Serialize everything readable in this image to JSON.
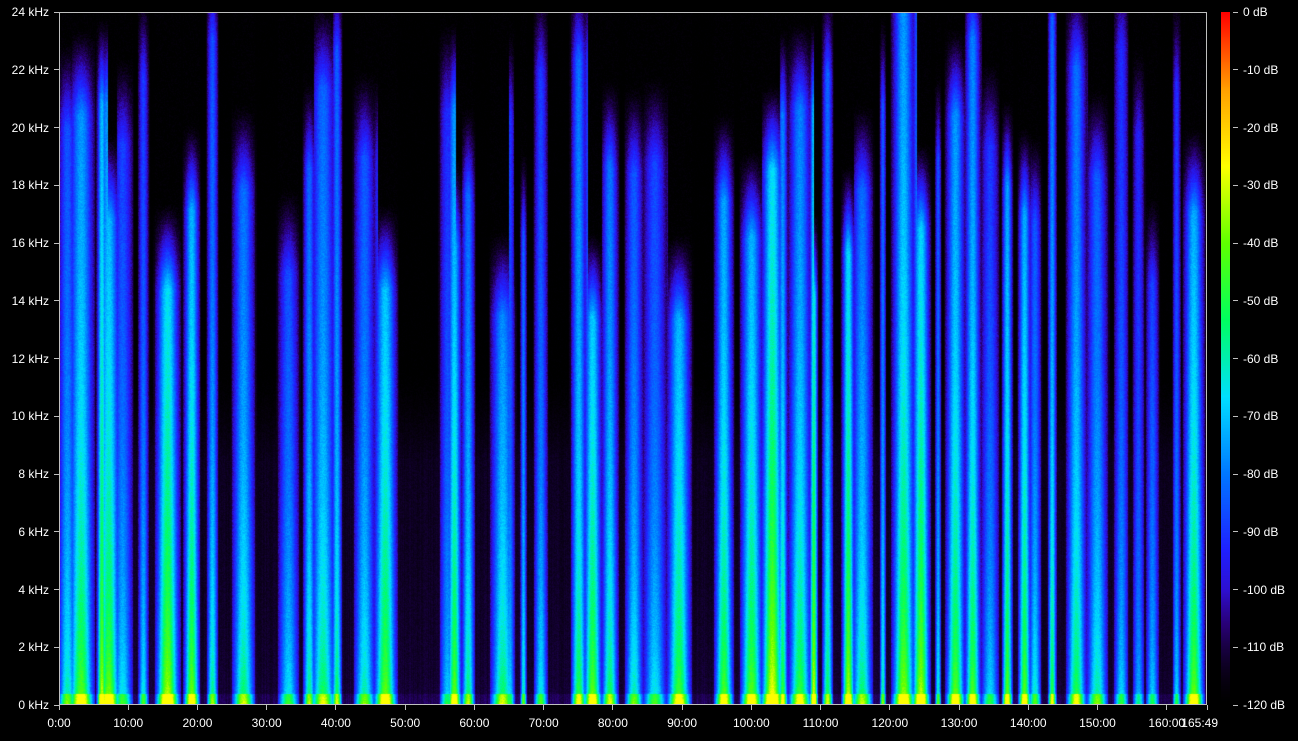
{
  "chart_data": {
    "type": "heatmap",
    "title": "",
    "xlabel": "",
    "ylabel": "",
    "x_unit": "time (min:sec)",
    "x_range_seconds": [
      0,
      9949
    ],
    "x_ticks": [
      "0:00",
      "10:00",
      "20:00",
      "30:00",
      "40:00",
      "50:00",
      "60:00",
      "70:00",
      "80:00",
      "90:00",
      "100:00",
      "110:00",
      "120:00",
      "130:00",
      "140:00",
      "150:00",
      "160:00",
      "165:49"
    ],
    "y_range_khz": [
      0,
      24
    ],
    "y_ticks": [
      "0 kHz",
      "2 kHz",
      "4 kHz",
      "6 kHz",
      "8 kHz",
      "10 kHz",
      "12 kHz",
      "14 kHz",
      "16 kHz",
      "18 kHz",
      "20 kHz",
      "22 kHz",
      "24 kHz"
    ],
    "colorbar_range_db": [
      -120,
      0
    ],
    "colorbar_ticks": [
      "0 dB",
      "-10 dB",
      "-20 dB",
      "-30 dB",
      "-40 dB",
      "-50 dB",
      "-60 dB",
      "-70 dB",
      "-80 dB",
      "-90 dB",
      "-100 dB",
      "-110 dB",
      "-120 dB"
    ],
    "colormap": [
      "#1a0030",
      "#3b00a8",
      "#2020ff",
      "#0078ff",
      "#00e0ff",
      "#00ff60",
      "#60ff00",
      "#ffff00",
      "#ffa000",
      "#ff0000"
    ],
    "background": "#000000",
    "bursts_minutes": [
      1,
      3,
      6,
      7,
      9,
      12,
      15.5,
      19,
      22,
      26.5,
      33,
      36,
      38,
      40,
      44,
      47,
      56,
      57,
      59,
      64,
      65,
      67,
      69.5,
      75,
      77,
      79.5,
      83,
      86,
      89.5,
      96,
      100,
      103,
      104.5,
      107,
      109,
      111,
      114,
      116,
      119,
      122,
      124.5,
      127,
      129.5,
      132,
      134.5,
      137,
      139.5,
      141,
      143.5,
      147,
      150,
      153.5,
      156,
      158,
      161.5,
      164
    ],
    "grid": false
  }
}
